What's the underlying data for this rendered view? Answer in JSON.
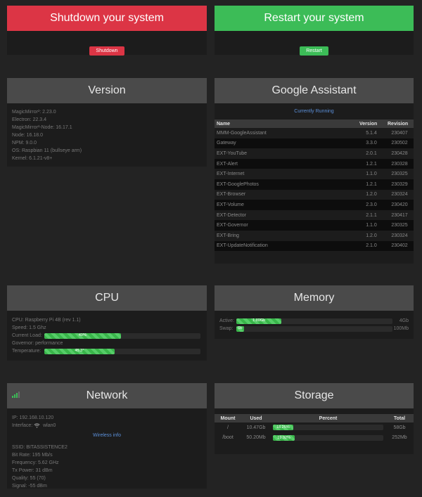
{
  "shutdown": {
    "title": "Shutdown your system",
    "button": "Shutdown"
  },
  "restart": {
    "title": "Restart your system",
    "button": "Restart"
  },
  "version": {
    "title": "Version",
    "lines": [
      "MagicMirror²: 2.23.0",
      "Electron: 22.3.4",
      "MagicMirror²-Node: 16.17.1",
      "Node: 16.18.0",
      "NPM: 9.0.0",
      "OS: Raspbian 11 (bullseye arm)",
      "Kernel: 6.1.21-v8+"
    ]
  },
  "assistant": {
    "title": "Google Assistant",
    "status": "Currently Running",
    "headers": [
      "Name",
      "Version",
      "Revision"
    ],
    "rows": [
      [
        "MMM-GoogleAssistant",
        "5.1.4",
        "230407"
      ],
      [
        "Gateway",
        "3.3.0",
        "230502"
      ],
      [
        "EXT-YouTube",
        "2.0.1",
        "230428"
      ],
      [
        "EXT-Alert",
        "1.2.1",
        "230328"
      ],
      [
        "EXT-Internet",
        "1.1.0",
        "230325"
      ],
      [
        "EXT-GooglePhotos",
        "1.2.1",
        "230329"
      ],
      [
        "EXT-Browser",
        "1.2.0",
        "230324"
      ],
      [
        "EXT-Volume",
        "2.3.0",
        "230420"
      ],
      [
        "EXT-Detector",
        "2.1.1",
        "230417"
      ],
      [
        "EXT-Governor",
        "1.1.0",
        "230325"
      ],
      [
        "EXT-Bring",
        "1.2.0",
        "230324"
      ],
      [
        "EXT-UpdateNotification",
        "2.1.0",
        "230402"
      ]
    ]
  },
  "cpu": {
    "title": "CPU",
    "model": "CPU: Raspberry Pi 4B (rev 1.1)",
    "speed": "Speed: 1.5 Ghz",
    "load_label": "Current Load:",
    "load_text": "49%",
    "load_value": 0.49,
    "governor": "Governor: performance",
    "temp_label": "Temperature:",
    "temp_text": "45.3°",
    "temp_value": 0.45
  },
  "memory": {
    "title": "Memory",
    "active_label": "Active:",
    "active_text": "1.89Gb",
    "active_total": "4Gb",
    "active_value": 0.29,
    "swap_label": "Swap:",
    "swap_text": "0b",
    "swap_total": "100Mb",
    "swap_value": 0.05
  },
  "network": {
    "title": "Network",
    "ip": "IP: 192.168.10.120",
    "interface_label": "Interface:",
    "interface_value": "wlan0",
    "wireless_title": "Wireless info",
    "lines": [
      "SSID: BITASSISTENCE2",
      "Bit Rate: 195 Mb/s",
      "Frequency: 5.62 GHz",
      "Tx Power: 31 dBm",
      "Quality: 55 (70)",
      "Signal: -55 dBm"
    ]
  },
  "storage": {
    "title": "Storage",
    "headers": [
      "Mount",
      "Used",
      "Percent",
      "Total"
    ],
    "rows": [
      {
        "mount": "/",
        "used": "10.47Gb",
        "percent": "18.25%",
        "percent_value": 0.1825,
        "total": "58Gb"
      },
      {
        "mount": "/boot",
        "used": "50.20Mb",
        "percent": "19.92%",
        "percent_value": 0.1992,
        "total": "252Mb"
      }
    ]
  },
  "colors": {
    "red": "#dc3545",
    "green": "#3cbc57",
    "header": "#4a4a4a",
    "link": "#5b8fd8"
  }
}
